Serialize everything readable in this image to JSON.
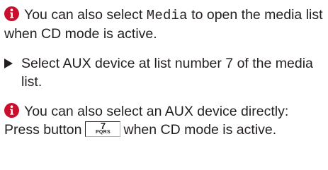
{
  "note1": {
    "icon": "info-icon",
    "text_before": "You can also select ",
    "mono_word": "Media",
    "text_after": " to open the media list when CD mode is active."
  },
  "step": {
    "marker": "triangle-right-icon",
    "text": "Select AUX device at list number 7 of the media list."
  },
  "note2": {
    "icon": "info-icon",
    "text_before": "You can also select an AUX device directly: Press button",
    "key": {
      "number": "7",
      "letters": "PQRS"
    },
    "text_after": "when CD mode is active."
  },
  "colors": {
    "icon_fill": "#c8102e",
    "text": "#231f20"
  }
}
